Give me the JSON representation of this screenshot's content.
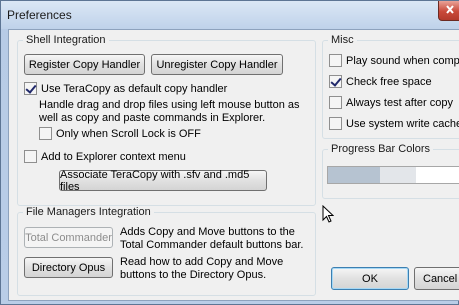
{
  "window": {
    "title": "Preferences"
  },
  "shell": {
    "legend": "Shell Integration",
    "register_label": "Register Copy Handler",
    "unregister_label": "Unregister Copy Handler",
    "default_handler_label": "Use TeraCopy as default copy handler",
    "default_handler_checked": true,
    "default_handler_desc": "Handle drag and drop files using left mouse button as well as copy and paste commands in Explorer.",
    "scroll_lock_label": "Only when Scroll Lock is OFF",
    "scroll_lock_checked": false,
    "context_menu_label": "Add to Explorer context menu",
    "context_menu_checked": false,
    "associate_label": "Associate TeraCopy with .sfv and .md5 files"
  },
  "file_managers": {
    "legend": "File Managers Integration",
    "total_commander_label": "Total Commander",
    "total_commander_desc": "Adds Copy and Move buttons to the Total Commander default buttons bar.",
    "directory_opus_label": "Directory Opus",
    "directory_opus_desc": "Read how to add Copy and Move buttons to the Directory Opus."
  },
  "misc": {
    "legend": "Misc",
    "items": [
      {
        "label": "Play sound when complete",
        "checked": false
      },
      {
        "label": "Check free space",
        "checked": true
      },
      {
        "label": "Always test after copy",
        "checked": false
      },
      {
        "label": "Use system write cache",
        "checked": false
      }
    ]
  },
  "progress_colors": {
    "legend": "Progress Bar Colors",
    "colors": [
      "#b6c3d1",
      "#e3e6ea",
      "#ffffff"
    ]
  },
  "footer": {
    "ok_label": "OK",
    "cancel_label": "Cancel"
  }
}
